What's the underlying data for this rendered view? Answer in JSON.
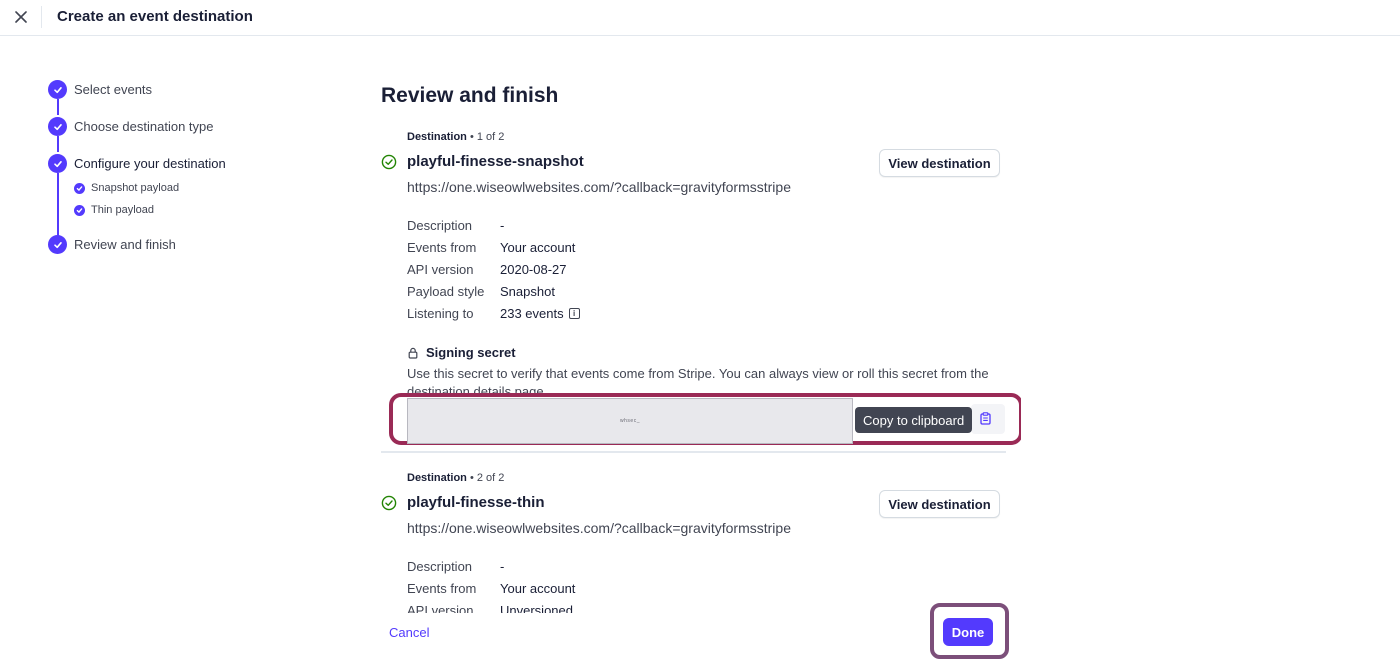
{
  "header": {
    "title": "Create an event destination"
  },
  "stepper": {
    "steps": [
      {
        "label": "Select events"
      },
      {
        "label": "Choose destination type"
      },
      {
        "label": "Configure your destination"
      },
      {
        "label": "Review and finish"
      }
    ],
    "substeps": [
      {
        "label": "Snapshot payload"
      },
      {
        "label": "Thin payload"
      }
    ]
  },
  "main": {
    "title": "Review and finish",
    "destinations": [
      {
        "meta_label": "Destination",
        "meta_count": "1 of 2",
        "name": "playful-finesse-snapshot",
        "url": "https://one.wiseowlwebsites.com/?callback=gravityformsstripe",
        "view_button": "View destination",
        "details": [
          {
            "key": "Description",
            "value": "-"
          },
          {
            "key": "Events from",
            "value": "Your account"
          },
          {
            "key": "API version",
            "value": "2020-08-27"
          },
          {
            "key": "Payload style",
            "value": "Snapshot"
          },
          {
            "key": "Listening to",
            "value": "233 events"
          }
        ]
      },
      {
        "meta_label": "Destination",
        "meta_count": "2 of 2",
        "name": "playful-finesse-thin",
        "url": "https://one.wiseowlwebsites.com/?callback=gravityformsstripe",
        "view_button": "View destination",
        "details": [
          {
            "key": "Description",
            "value": "-"
          },
          {
            "key": "Events from",
            "value": "Your account"
          },
          {
            "key": "API version",
            "value": "Unversioned"
          }
        ]
      }
    ],
    "signing_secret": {
      "title": "Signing secret",
      "description": "Use this secret to verify that events come from Stripe. You can always view or roll this secret from the destination details page.",
      "masked_value": "whsec_",
      "copy_tooltip": "Copy to clipboard"
    }
  },
  "footer": {
    "cancel_label": "Cancel",
    "done_label": "Done"
  },
  "colors": {
    "accent": "#533afd",
    "success": "#228403",
    "highlight_secret": "#9a2a56",
    "highlight_done": "#7c4f7a"
  },
  "icons": {
    "close": "close-icon",
    "check": "check-icon",
    "success": "check-circle-icon",
    "lock": "lock-icon",
    "info": "info-icon",
    "clipboard": "clipboard-icon"
  }
}
